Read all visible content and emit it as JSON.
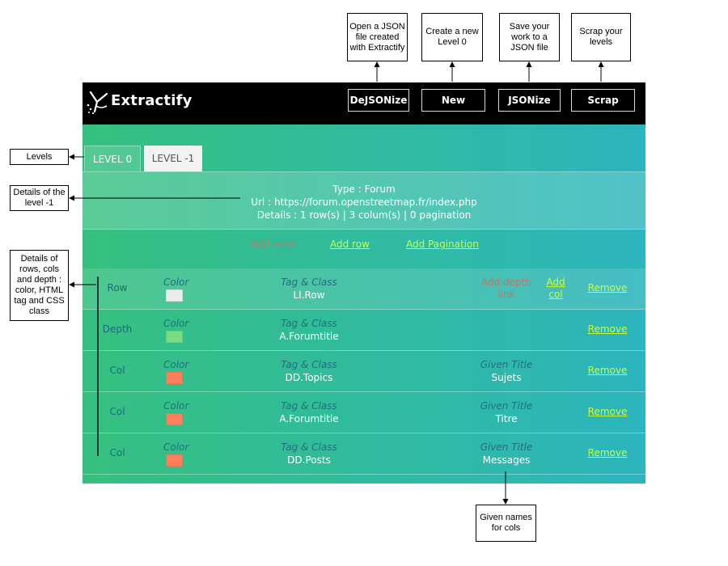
{
  "app": {
    "brand": "Extractify"
  },
  "toolbar": {
    "dejsonize": "DeJSONize",
    "new": "New",
    "jsonize": "JSONize",
    "scrap": "Scrap"
  },
  "tabs": [
    {
      "label": "LEVEL 0",
      "selected": false
    },
    {
      "label": "LEVEL -1",
      "selected": true
    }
  ],
  "details": {
    "type": "Type : Forum",
    "url": "Url : https://forum.openstreetmap.fr/index.php",
    "summary": "Details : 1 row(s) | 3 colum(s) | 0 pagination"
  },
  "actions": {
    "add_level": "Add level",
    "add_row": "Add row",
    "add_pagination": "Add Pagination"
  },
  "captions": {
    "color": "Color",
    "tag_class": "Tag & Class",
    "given_title": "Given Title",
    "add_depth_link": "Add depth link",
    "add_col": "Add col",
    "remove": "Remove"
  },
  "rows": [
    {
      "kind": "Row",
      "color": "#ececec",
      "tag": "LI.Row",
      "title": ""
    },
    {
      "kind": "Depth",
      "color": "#7ddb7f",
      "tag": "A.Forumtitle",
      "title": ""
    },
    {
      "kind": "Col",
      "color": "#ff7f5a",
      "tag": "DD.Topics",
      "title": "Sujets"
    },
    {
      "kind": "Col",
      "color": "#ff7f5a",
      "tag": "A.Forumtitle",
      "title": "Titre"
    },
    {
      "kind": "Col",
      "color": "#ff7f5a",
      "tag": "DD.Posts",
      "title": "Messages"
    }
  ],
  "callouts": {
    "dejsonize": "Open a JSON file created with Extractify",
    "new": "Create a new Level 0",
    "jsonize": "Save your work to a JSON file",
    "scrap": "Scrap your levels",
    "levels": "Levels",
    "details": "Details of the level -1",
    "rows": "Details of rows, cols and depth : color, HTML tag and CSS class",
    "given": "Given names for cols"
  },
  "colors": {
    "topbar": "#000000",
    "link": "#c8ff3c",
    "disabled_link": "#b77a6f",
    "gradient_start": "#36c07f",
    "gradient_end": "#2cb5bd"
  }
}
